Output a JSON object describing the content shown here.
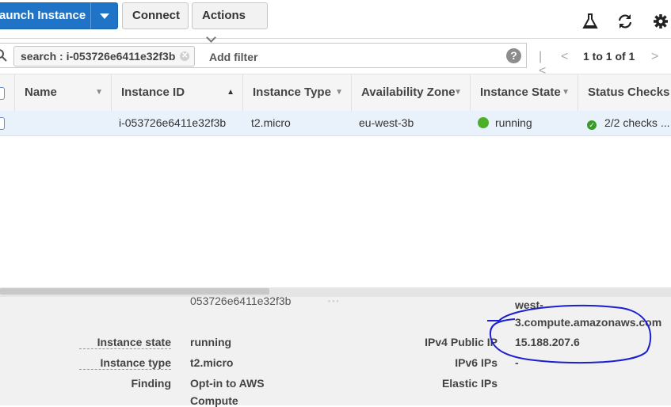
{
  "toolbar": {
    "launch_label": "aunch Instance",
    "connect_label": "Connect",
    "actions_label": "Actions",
    "icons": [
      "flask-icon",
      "refresh-icon",
      "gear-icon"
    ]
  },
  "filter": {
    "token": "search : i-053726e6411e32f3b",
    "add_filter": "Add filter",
    "pager_text": "1 to 1 of 1",
    "help": "?"
  },
  "table": {
    "columns": [
      "Name",
      "Instance ID",
      "Instance Type",
      "Availability Zone",
      "Instance State",
      "Status Checks"
    ],
    "rows": [
      {
        "name": "",
        "instance_id": "i-053726e6411e32f3b",
        "instance_type": "t2.micro",
        "availability_zone": "eu-west-3b",
        "instance_state": "running",
        "status_checks": "2/2 checks ..."
      }
    ]
  },
  "details": {
    "cut_id": "053726e6411e32f3b",
    "left": [
      {
        "label": "Instance state",
        "value": "running"
      },
      {
        "label": "Instance type",
        "value": "t2.micro"
      },
      {
        "label": "Finding",
        "value": "Opt-in to AWS"
      }
    ],
    "finding_cont": "Compute",
    "dns_line1": "west-",
    "dns_line2": "3.compute.amazonaws.com",
    "right": [
      {
        "label": "IPv4 Public IP",
        "value": "15.188.207.6"
      },
      {
        "label": "IPv6 IPs",
        "value": "-"
      },
      {
        "label": "Elastic IPs",
        "value": ""
      }
    ]
  },
  "colors": {
    "primary_button": "#1f74c7",
    "running": "#4caf2a",
    "annotation": "#1a1fd1"
  }
}
